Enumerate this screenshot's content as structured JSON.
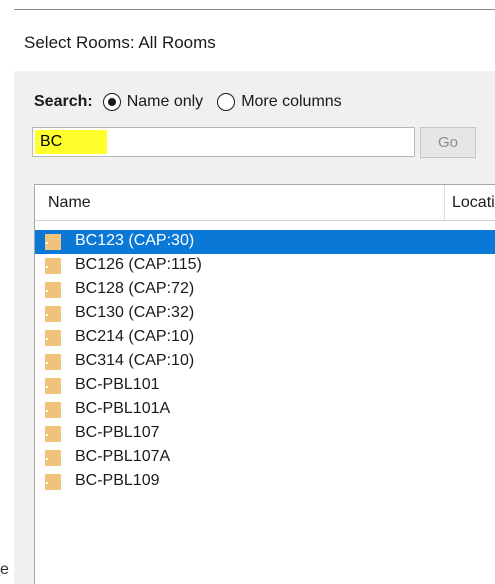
{
  "title": "Select Rooms: All Rooms",
  "search": {
    "label": "Search:",
    "options": [
      {
        "label": "Name only",
        "selected": true
      },
      {
        "label": "More columns",
        "selected": false
      }
    ],
    "value": "BC",
    "go_label": "Go"
  },
  "table": {
    "columns": [
      "Name",
      "Locati"
    ],
    "rows": [
      {
        "name": "BC123 (CAP:30)",
        "selected": true
      },
      {
        "name": "BC126 (CAP:115)",
        "selected": false
      },
      {
        "name": "BC128 (CAP:72)",
        "selected": false
      },
      {
        "name": "BC130 (CAP:32)",
        "selected": false
      },
      {
        "name": "BC214 (CAP:10)",
        "selected": false
      },
      {
        "name": "BC314 (CAP:10)",
        "selected": false
      },
      {
        "name": "BC-PBL101",
        "selected": false
      },
      {
        "name": "BC-PBL101A",
        "selected": false
      },
      {
        "name": "BC-PBL107",
        "selected": false
      },
      {
        "name": "BC-PBL107A",
        "selected": false
      },
      {
        "name": "BC-PBL109",
        "selected": false
      }
    ]
  },
  "stray_text": "e",
  "colors": {
    "highlight": "#ffff2b",
    "selection": "#0a78d7",
    "room_icon": "#f0c27a"
  }
}
